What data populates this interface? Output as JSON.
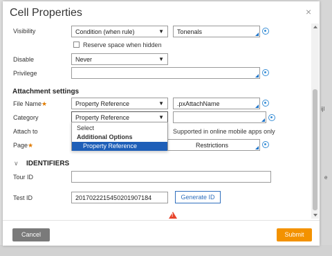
{
  "background": {
    "frag_ijl": "ijl",
    "frag_e": "e"
  },
  "dialog": {
    "title": "Cell Properties",
    "close_glyph": "×",
    "close_icon": "close-icon"
  },
  "form": {
    "visibility": {
      "label": "Visibility",
      "select_value": "Condition (when rule)",
      "input_value": "Tonenals"
    },
    "reserve_space": {
      "label": "Reserve space when hidden",
      "checked": false
    },
    "disable": {
      "label": "Disable",
      "select_value": "Never"
    },
    "privilege": {
      "label": "Privilege",
      "input_value": ""
    },
    "attachment_section": {
      "title": "Attachment settings"
    },
    "file_name": {
      "label": "File Name",
      "required_mark": "★",
      "select_value": "Property Reference",
      "input_value": ".pxAttachName"
    },
    "category": {
      "label": "Category",
      "select_value": "Property Reference",
      "input_value": ""
    },
    "attach_to": {
      "label": "Attach to",
      "note": "Supported in online mobile apps only"
    },
    "page": {
      "label": "Page",
      "required_mark": "★",
      "input_value": "Restrictions"
    },
    "dropdown_options": [
      {
        "label": "Select"
      },
      {
        "label": "Additional Options"
      },
      {
        "label": "Property Reference"
      }
    ],
    "identifiers_section": {
      "chevron": "∨",
      "title": "IDENTIFIERS"
    },
    "tour_id": {
      "label": "Tour ID",
      "input_value": ""
    },
    "test_id": {
      "label": "Test ID",
      "input_value": "20170222154502019071​84",
      "generate_label": "Generate ID"
    },
    "warning_icon": "warning-icon"
  },
  "footer": {
    "cancel_label": "Cancel",
    "submit_label": "Submit"
  },
  "colors": {
    "accent_blue": "#1d73c8",
    "required_orange": "#e07b00",
    "submit_orange": "#f39200",
    "cancel_gray": "#7a7a7a",
    "highlight_blue": "#1e5fb8",
    "warning_red": "#e8452c"
  },
  "caret_glyph": "▼",
  "warning_glyph": "!"
}
